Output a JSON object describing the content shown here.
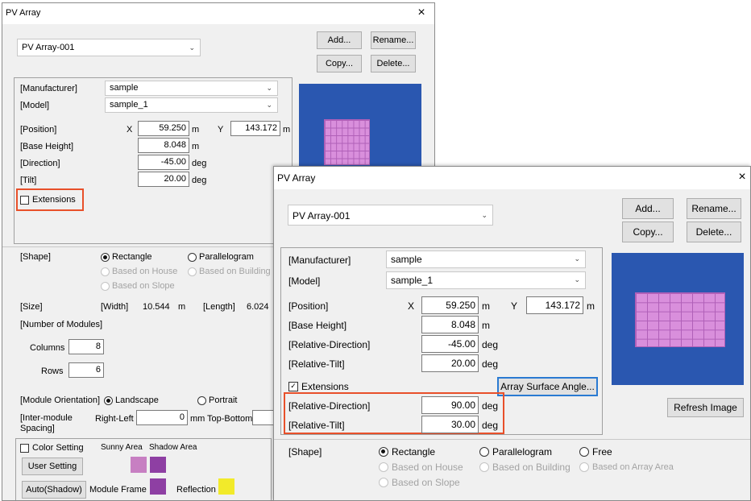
{
  "back_window": {
    "title": "PV Array",
    "close_glyph": "×",
    "array_select": "PV Array-001",
    "buttons": {
      "add": "Add...",
      "rename": "Rename...",
      "copy": "Copy...",
      "delete": "Delete..."
    },
    "manufacturer_label": "[Manufacturer]",
    "manufacturer_value": "sample",
    "model_label": "[Model]",
    "model_value": "sample_1",
    "position_label": "[Position]",
    "x_label": "X",
    "x_value": "59.250",
    "x_unit": "m",
    "y_label": "Y",
    "y_value": "143.172",
    "y_unit": "m",
    "base_height_label": "[Base Height]",
    "base_height_value": "8.048",
    "base_height_unit": "m",
    "direction_label": "[Direction]",
    "direction_value": "-45.00",
    "direction_unit": "deg",
    "tilt_label": "[Tilt]",
    "tilt_value": "20.00",
    "tilt_unit": "deg",
    "extensions_label": "Extensions",
    "extensions_checked": false,
    "shape_label": "[Shape]",
    "shape_rectangle": "Rectangle",
    "shape_parallelogram": "Parallelogram",
    "based_on_house": "Based on House",
    "based_on_building": "Based on Building",
    "based_on_slope": "Based on Slope",
    "size_label": "[Size]",
    "width_label": "[Width]",
    "width_value": "10.544",
    "width_unit": "m",
    "length_label": "[Length]",
    "length_value": "6.024",
    "num_modules_label": "[Number of Modules]",
    "columns_label": "Columns",
    "columns_value": "8",
    "rows_label": "Rows",
    "rows_value": "6",
    "orientation_label": "[Module Orientation]",
    "landscape_label": "Landscape",
    "portrait_label": "Portrait",
    "spacing_label_1": "[Inter-module",
    "spacing_label_2": "Spacing]",
    "right_left_label": "Right-Left",
    "right_left_value": "0",
    "right_left_unit": "mm",
    "top_bottom_label": "Top-Bottom",
    "color_setting_label": "Color Setting",
    "sunny_area_label": "Sunny Area",
    "shadow_area_label": "Shadow Area",
    "user_setting_btn": "User Setting",
    "auto_shadow_btn": "Auto(Shadow)",
    "module_frame_label": "Module Frame",
    "reflection_label": "Reflection"
  },
  "front_window": {
    "title": "PV Array",
    "close_glyph": "×",
    "array_select": "PV Array-001",
    "buttons": {
      "add": "Add...",
      "rename": "Rename...",
      "copy": "Copy...",
      "delete": "Delete..."
    },
    "manufacturer_label": "[Manufacturer]",
    "manufacturer_value": "sample",
    "model_label": "[Model]",
    "model_value": "sample_1",
    "position_label": "[Position]",
    "x_label": "X",
    "x_value": "59.250",
    "x_unit": "m",
    "y_label": "Y",
    "y_value": "143.172",
    "y_unit": "m",
    "base_height_label": "[Base Height]",
    "base_height_value": "8.048",
    "base_height_unit": "m",
    "rel_direction_label": "[Relative-Direction]",
    "rel_direction_value": "-45.00",
    "rel_direction_unit": "deg",
    "rel_tilt_label": "[Relative-Tilt]",
    "rel_tilt_value": "20.00",
    "rel_tilt_unit": "deg",
    "extensions_label": "Extensions",
    "extensions_checked": true,
    "array_surface_btn": "Array Surface Angle...",
    "ext_rel_direction_label": "[Relative-Direction]",
    "ext_rel_direction_value": "90.00",
    "ext_rel_direction_unit": "deg",
    "ext_rel_tilt_label": "[Relative-Tilt]",
    "ext_rel_tilt_value": "30.00",
    "ext_rel_tilt_unit": "deg",
    "refresh_btn": "Refresh Image",
    "shape_label": "[Shape]",
    "shape_rectangle": "Rectangle",
    "shape_parallelogram": "Parallelogram",
    "shape_free": "Free",
    "based_on_house": "Based on House",
    "based_on_building": "Based on Building",
    "based_on_array_area": "Based on Array Area",
    "based_on_slope": "Based on Slope"
  },
  "colors": {
    "preview_bg": "#2a57b0",
    "module_fill": "#d98fdc",
    "sunny_area": "#c77fc2",
    "shadow_area": "#8e3fa3",
    "module_frame": "#8e3fa3",
    "reflection": "#f2ea2a",
    "highlight": "#e8502a",
    "focus_border": "#2a7ad2"
  }
}
